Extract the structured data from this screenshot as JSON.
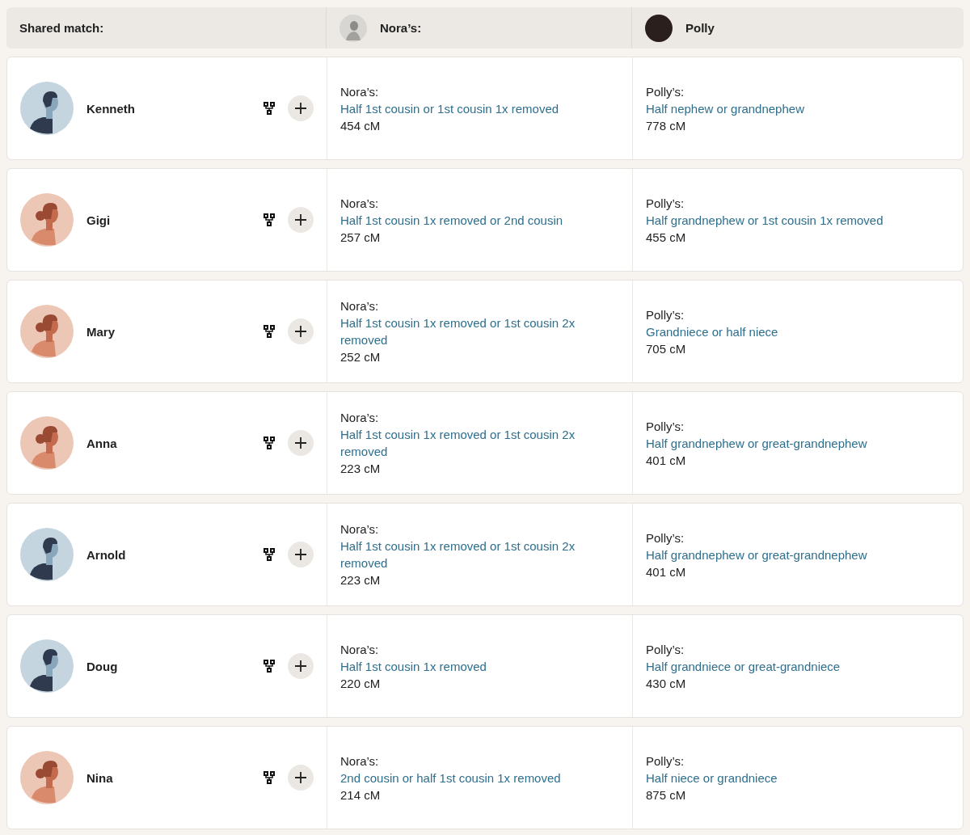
{
  "header": {
    "label": "Shared match:",
    "columns": [
      {
        "name": "Nora’s:",
        "kind": "silhouette"
      },
      {
        "name": "Polly",
        "kind": "photo"
      }
    ]
  },
  "matches": [
    {
      "name": "Kenneth",
      "kind": "male",
      "a": {
        "label": "Nora’s:",
        "relation": "Half 1st cousin or 1st cousin 1x removed",
        "cm": "454 cM"
      },
      "b": {
        "label": "Polly’s:",
        "relation": "Half nephew or grandnephew",
        "cm": "778 cM"
      }
    },
    {
      "name": "Gigi",
      "kind": "female",
      "a": {
        "label": "Nora’s:",
        "relation": "Half 1st cousin 1x removed or 2nd cousin",
        "cm": "257 cM"
      },
      "b": {
        "label": "Polly’s:",
        "relation": "Half grandnephew or 1st cousin 1x removed",
        "cm": "455 cM"
      }
    },
    {
      "name": "Mary",
      "kind": "female",
      "a": {
        "label": "Nora’s:",
        "relation": "Half 1st cousin 1x removed or 1st cousin 2x removed",
        "cm": "252 cM"
      },
      "b": {
        "label": "Polly’s:",
        "relation": "Grandniece or half niece",
        "cm": "705 cM"
      }
    },
    {
      "name": "Anna",
      "kind": "female",
      "a": {
        "label": "Nora’s:",
        "relation": "Half 1st cousin 1x removed or 1st cousin 2x removed",
        "cm": "223 cM"
      },
      "b": {
        "label": "Polly’s:",
        "relation": "Half grandnephew or great-grandnephew",
        "cm": "401 cM"
      }
    },
    {
      "name": "Arnold",
      "kind": "male",
      "a": {
        "label": "Nora’s:",
        "relation": "Half 1st cousin 1x removed or 1st cousin 2x removed",
        "cm": "223 cM"
      },
      "b": {
        "label": "Polly’s:",
        "relation": "Half grandnephew or great-grandnephew",
        "cm": "401 cM"
      }
    },
    {
      "name": "Doug",
      "kind": "male",
      "a": {
        "label": "Nora’s:",
        "relation": "Half 1st cousin 1x removed",
        "cm": "220 cM"
      },
      "b": {
        "label": "Polly’s:",
        "relation": "Half grandniece or great-grandniece",
        "cm": "430 cM"
      }
    },
    {
      "name": "Nina",
      "kind": "female",
      "a": {
        "label": "Nora’s:",
        "relation": "2nd cousin or half 1st cousin 1x removed",
        "cm": "214 cM"
      },
      "b": {
        "label": "Polly’s:",
        "relation": "Half niece or grandniece",
        "cm": "875 cM"
      }
    }
  ]
}
